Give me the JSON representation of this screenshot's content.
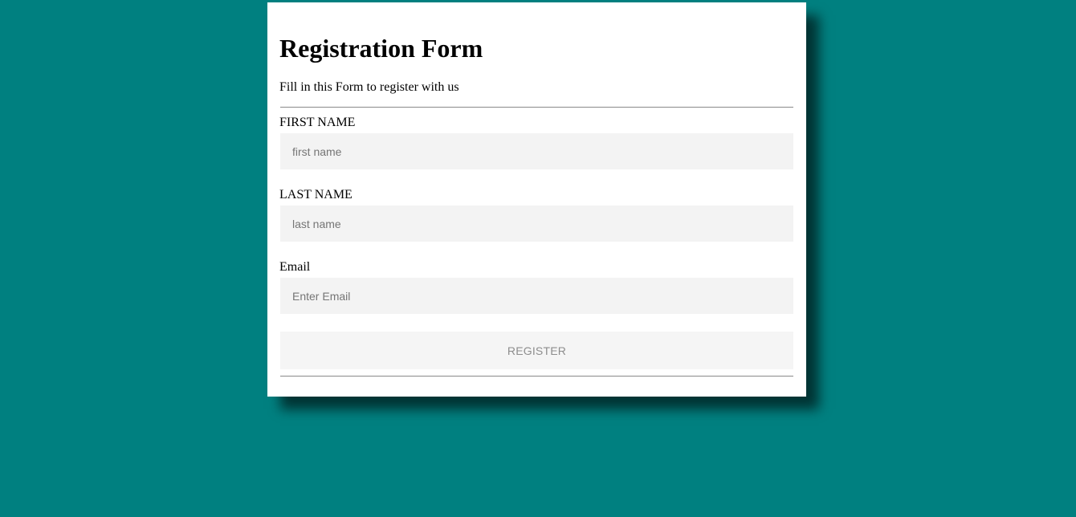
{
  "form": {
    "title": "Registration Form",
    "subtitle": "Fill in this Form to register with us",
    "fields": [
      {
        "label": "FIRST NAME",
        "placeholder": "first name",
        "value": ""
      },
      {
        "label": "LAST NAME",
        "placeholder": "last name",
        "value": ""
      },
      {
        "label": "Email",
        "placeholder": "Enter Email",
        "value": ""
      }
    ],
    "register_label": "REGISTER"
  },
  "colors": {
    "page_background": "#008080",
    "card_background": "#ffffff",
    "input_background": "#f3f3f3",
    "button_background": "#f5f5f5",
    "button_text": "#8d8d8d"
  }
}
